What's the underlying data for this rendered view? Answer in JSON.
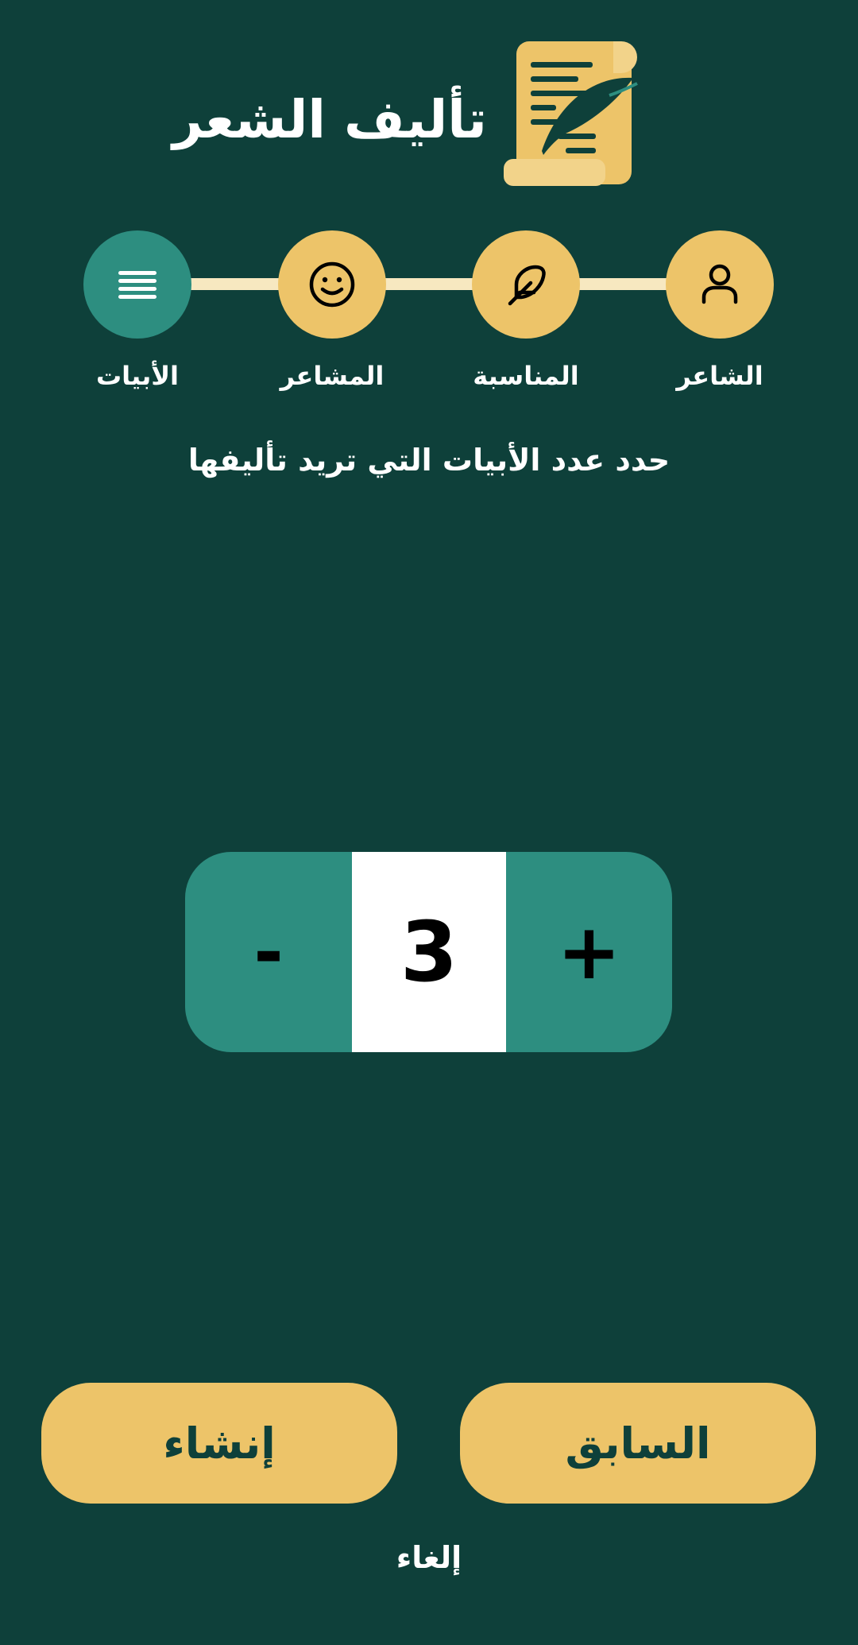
{
  "header": {
    "title": "تأليف الشعر",
    "logo_icon": "poetry-scroll-quill-icon"
  },
  "steps": [
    {
      "label": "الشاعر",
      "icon": "person-icon",
      "active": false
    },
    {
      "label": "المناسبة",
      "icon": "feather-icon",
      "active": false
    },
    {
      "label": "المشاعر",
      "icon": "smile-icon",
      "active": false
    },
    {
      "label": "الأبيات",
      "icon": "lines-icon",
      "active": true
    }
  ],
  "prompt": "حدد عدد الأبيات التي تريد تأليفها",
  "counter": {
    "minus_label": "-",
    "plus_label": "+",
    "value": "3"
  },
  "actions": {
    "previous_label": "السابق",
    "create_label": "إنشاء",
    "cancel_label": "إلغاء"
  },
  "colors": {
    "background": "#0e403a",
    "accent_gold": "#edc469",
    "accent_teal": "#2d8e80",
    "track": "#f7e8c0",
    "text": "#ffffff"
  }
}
